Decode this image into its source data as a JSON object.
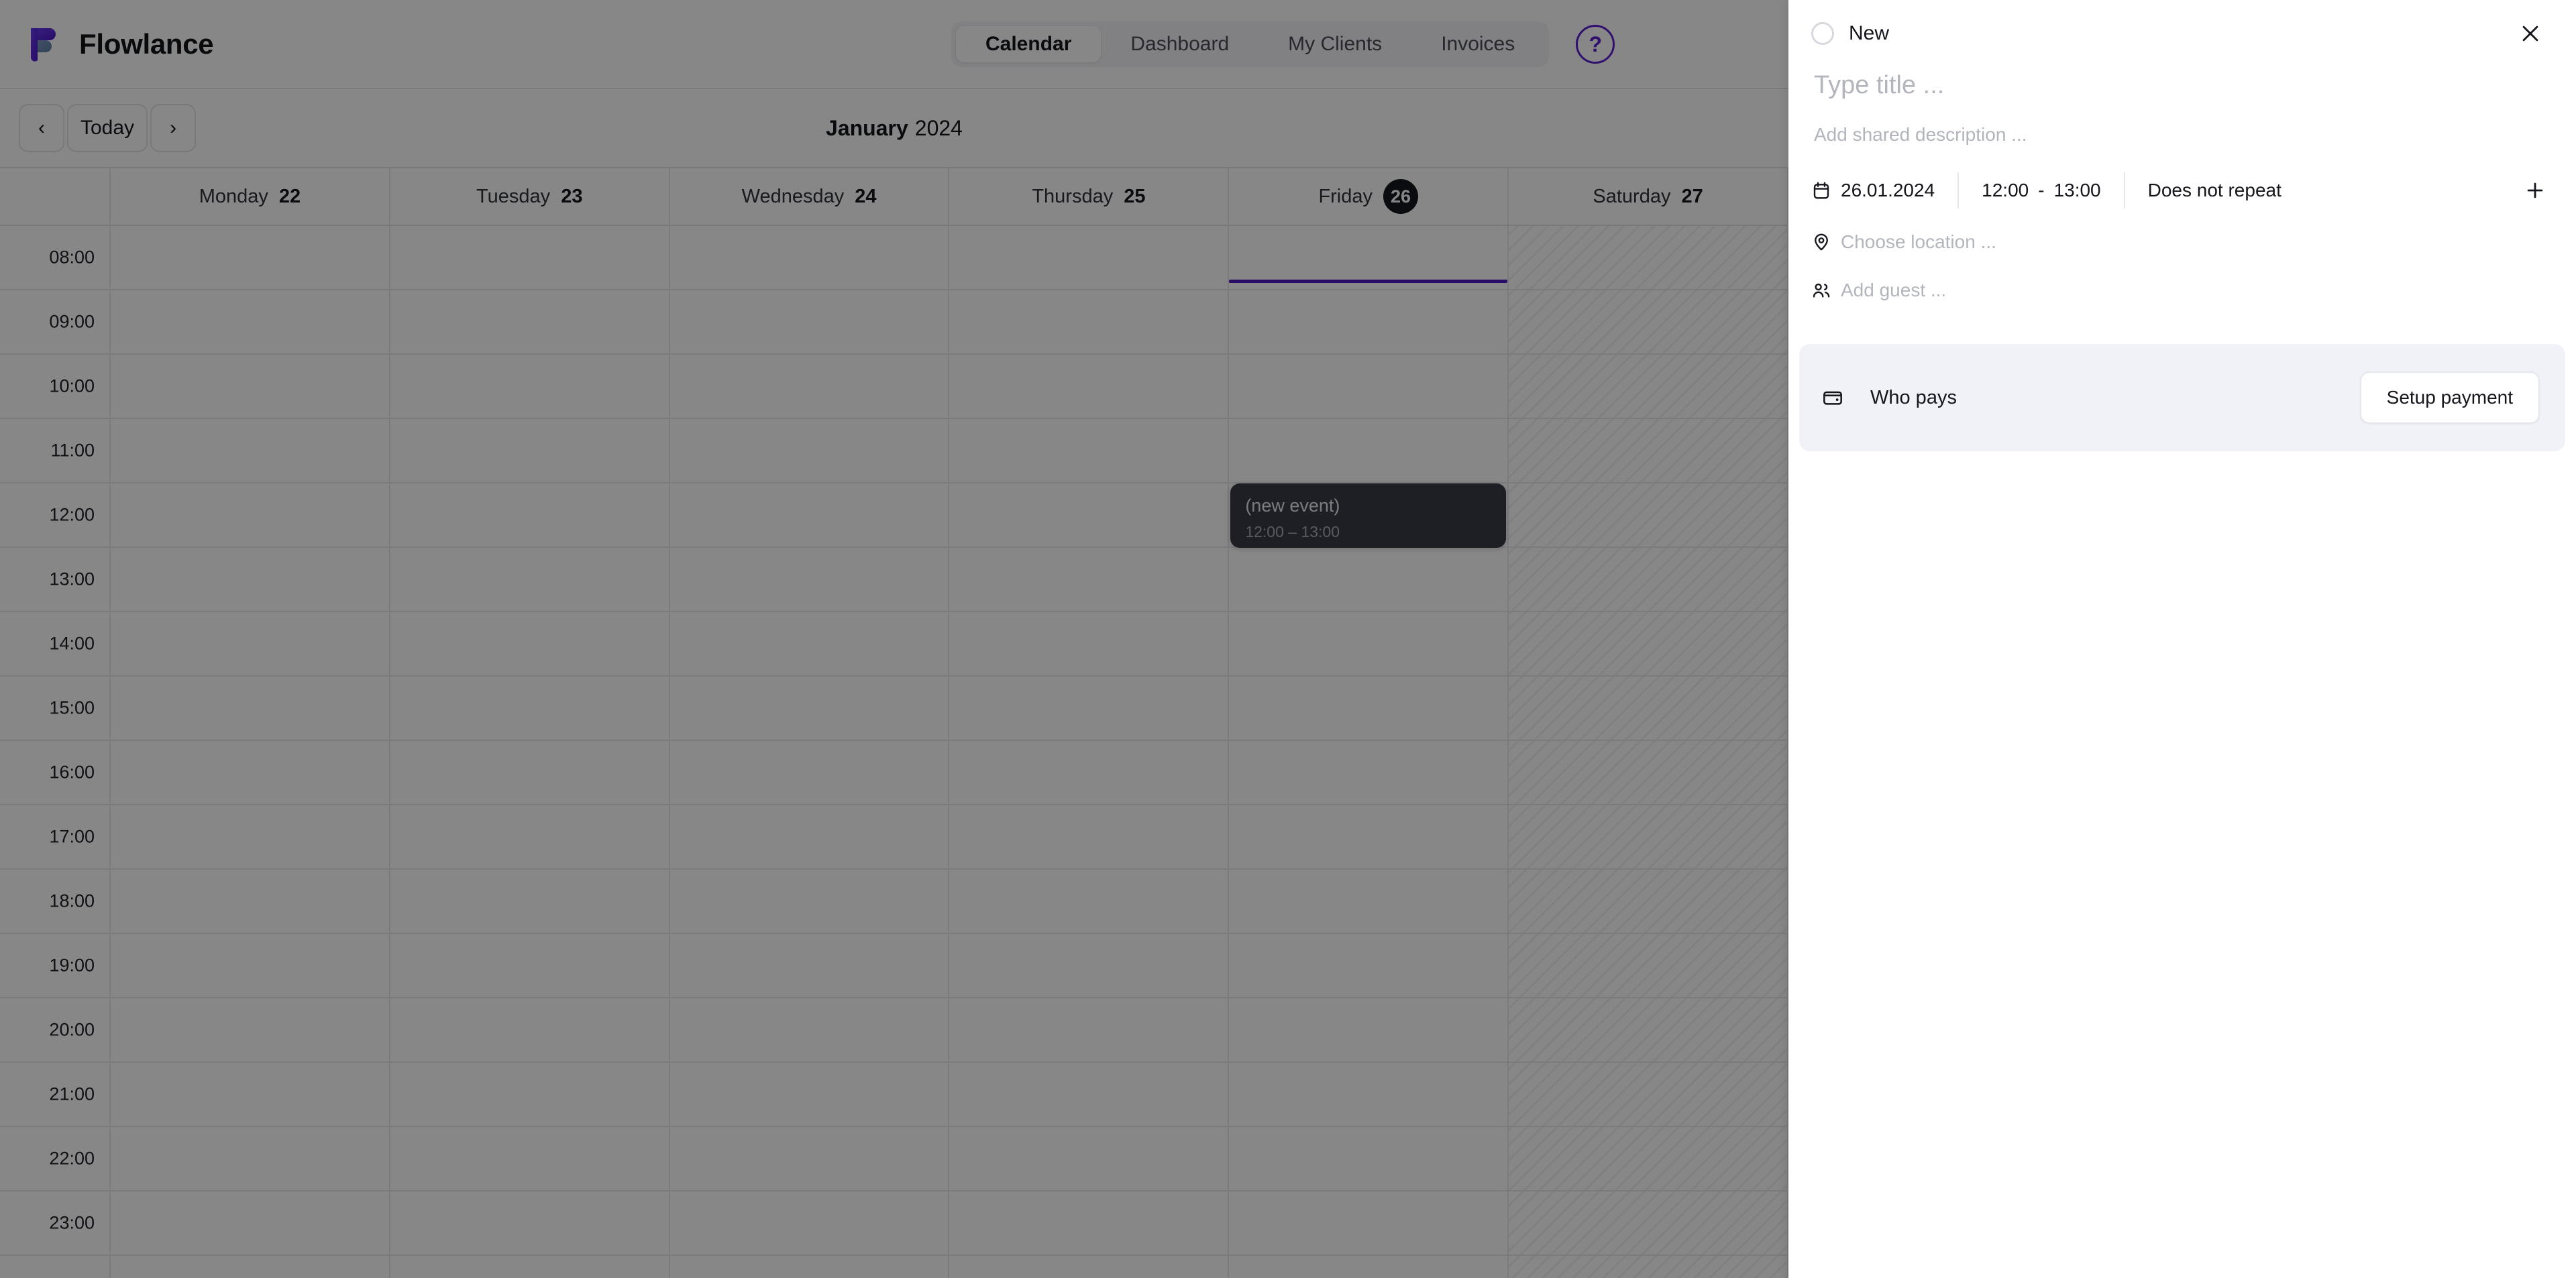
{
  "header": {
    "brand": "Flowlance",
    "logo_icon": "flowlance-f-logo",
    "nav": [
      {
        "label": "Calendar",
        "active": true
      },
      {
        "label": "Dashboard",
        "active": false
      },
      {
        "label": "My Clients",
        "active": false
      },
      {
        "label": "Invoices",
        "active": false
      }
    ],
    "help_label": "?",
    "help_icon": "question-mark-circle-icon",
    "accent_color": "#5b1fd1"
  },
  "toolbar": {
    "prev_label": "‹",
    "today_label": "Today",
    "next_label": "›",
    "month": "January",
    "year": "2024"
  },
  "calendar": {
    "days": [
      {
        "dow": "Monday",
        "date": "22",
        "today": false,
        "disabled": false
      },
      {
        "dow": "Tuesday",
        "date": "23",
        "today": false,
        "disabled": false
      },
      {
        "dow": "Wednesday",
        "date": "24",
        "today": false,
        "disabled": false
      },
      {
        "dow": "Thursday",
        "date": "25",
        "today": false,
        "disabled": false
      },
      {
        "dow": "Friday",
        "date": "26",
        "today": true,
        "disabled": false
      },
      {
        "dow": "Saturday",
        "date": "27",
        "today": false,
        "disabled": true
      }
    ],
    "hours": [
      "08:00",
      "09:00",
      "10:00",
      "11:00",
      "12:00",
      "13:00",
      "14:00",
      "15:00",
      "16:00",
      "17:00",
      "18:00",
      "19:00",
      "20:00",
      "21:00",
      "22:00",
      "23:00"
    ],
    "now_indicator": {
      "day_index": 4,
      "time": "08:50",
      "color": "#4a18c4"
    },
    "draft_event": {
      "title": "(new event)",
      "time_range": "12:00 – 13:00",
      "day_index": 4,
      "start": "12:00",
      "end": "13:00",
      "color": "#383c44"
    }
  },
  "panel": {
    "status_label": "New",
    "status_icon": "circle-outline-icon",
    "close_icon": "close-icon",
    "title_placeholder": "Type title ...",
    "title_value": "",
    "description_placeholder": "Add shared description ...",
    "description_value": "",
    "date_icon": "calendar-icon",
    "date_value": "26.01.2024",
    "time_start": "12:00",
    "time_sep": "-",
    "time_end": "13:00",
    "repeat_value": "Does not repeat",
    "add_more_label": "+",
    "add_more_icon": "plus-icon",
    "location_icon": "map-pin-icon",
    "location_placeholder": "Choose location ...",
    "guest_icon": "users-icon",
    "guest_placeholder": "Add guest ...",
    "payment": {
      "icon": "wallet-icon",
      "label": "Who pays",
      "button_label": "Setup payment",
      "card_bg": "#f1f2f8"
    }
  }
}
